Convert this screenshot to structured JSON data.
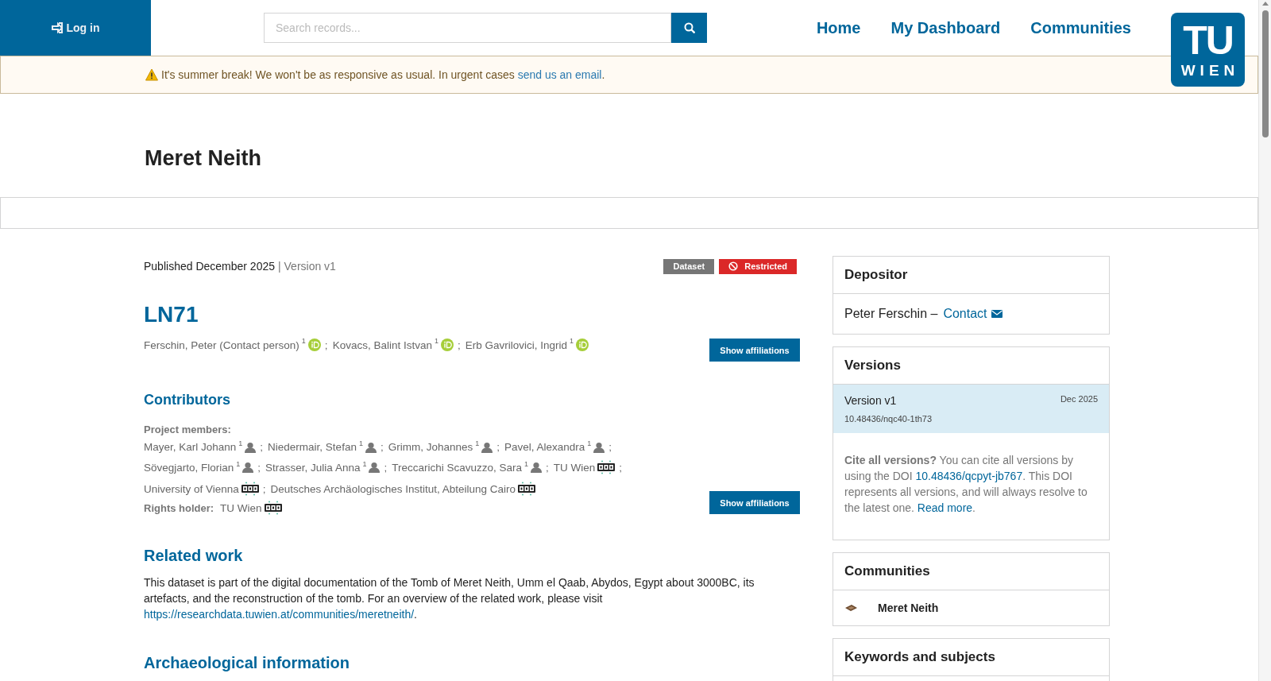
{
  "header": {
    "login": "Log in",
    "search": {
      "placeholder": "Search records..."
    },
    "nav": [
      {
        "label": "Home"
      },
      {
        "label": "My Dashboard"
      },
      {
        "label": "Communities"
      }
    ],
    "logo": {
      "top": "TU",
      "bottom": "WIEN"
    }
  },
  "banner": {
    "text": "It's summer break! We won't be as responsive as usual. In urgent cases",
    "link": "send us an email",
    "end": "."
  },
  "page_title": "Meret Neith",
  "record": {
    "published": "Published December 2025",
    "version": "| Version v1",
    "badges": [
      {
        "label": "Dataset",
        "kind": "type"
      },
      {
        "label": "Restricted",
        "kind": "access"
      }
    ],
    "title": "LN71",
    "separator": ";",
    "creators": [
      {
        "name": "Ferschin, Peter (Contact person)",
        "sup": "1",
        "orcid": true
      },
      {
        "name": "Kovacs, Balint Istvan",
        "sup": "1",
        "orcid": true
      },
      {
        "name": "Erb Gavrilovici, Ingrid",
        "sup": "1",
        "orcid": true
      }
    ],
    "show_affiliations": [
      "Show affiliations",
      "Show affiliations"
    ],
    "contributors_heading": "Contributors",
    "members_label": "Project members:",
    "members": [
      {
        "name": "Mayer, Karl Johann",
        "sup": "1",
        "kind": "person"
      },
      {
        "name": "Niedermair, Stefan",
        "sup": "1",
        "kind": "person"
      },
      {
        "name": "Grimm, Johannes",
        "sup": "1",
        "kind": "person"
      },
      {
        "name": "Pavel, Alexandra",
        "sup": "1",
        "kind": "person"
      },
      {
        "name": "Sövegjarto, Florian",
        "sup": "1",
        "kind": "person"
      },
      {
        "name": "Strasser, Julia Anna",
        "sup": "1",
        "kind": "person"
      },
      {
        "name": "Treccarichi Scavuzzo, Sara",
        "sup": "1",
        "kind": "person"
      },
      {
        "name": "TU Wien",
        "kind": "organization"
      },
      {
        "name": "University of Vienna",
        "kind": "organization"
      },
      {
        "name": "Deutsches Archäologisches Institut, Abteilung Cairo",
        "kind": "organization"
      }
    ],
    "rights_label": "Rights holder:",
    "rights_holders": [
      {
        "name": "TU Wien",
        "kind": "organization"
      }
    ],
    "related_heading": "Related work",
    "related_text": "This dataset is part of the digital documentation of the Tomb of Meret Neith, Umm el Qaab, Abydos, Egypt about 3000BC, its artefacts, and the reconstruction of the tomb. For an overview of the related work, please visit",
    "related_link": "https://researchdata.tuwien.at/communities/meretneith/",
    "related_end": ".",
    "archaeological_heading": "Archaeological information"
  },
  "sidebar": {
    "depositor": {
      "title": "Depositor",
      "name": "Peter Ferschin –",
      "contact": "Contact"
    },
    "versions": {
      "title": "Versions",
      "items": [
        {
          "label": "Version v1",
          "date": "Dec 2025",
          "doi": "10.48436/nqc40-1th73",
          "selected": true
        }
      ],
      "cite": "**Cite all versions?** You can cite all versions by using the DOI",
      "cite_doi": "10.48436/qcpyt-jb767",
      "cite_mid": ". This DOI represents all versions, and will always resolve to the latest one.",
      "cite_link": "Read more",
      "cite_end": "."
    },
    "communities": {
      "title": "Communities",
      "items": [
        {
          "name": "Meret Neith"
        }
      ]
    },
    "keywords": {
      "title": "Keywords and subjects"
    }
  }
}
